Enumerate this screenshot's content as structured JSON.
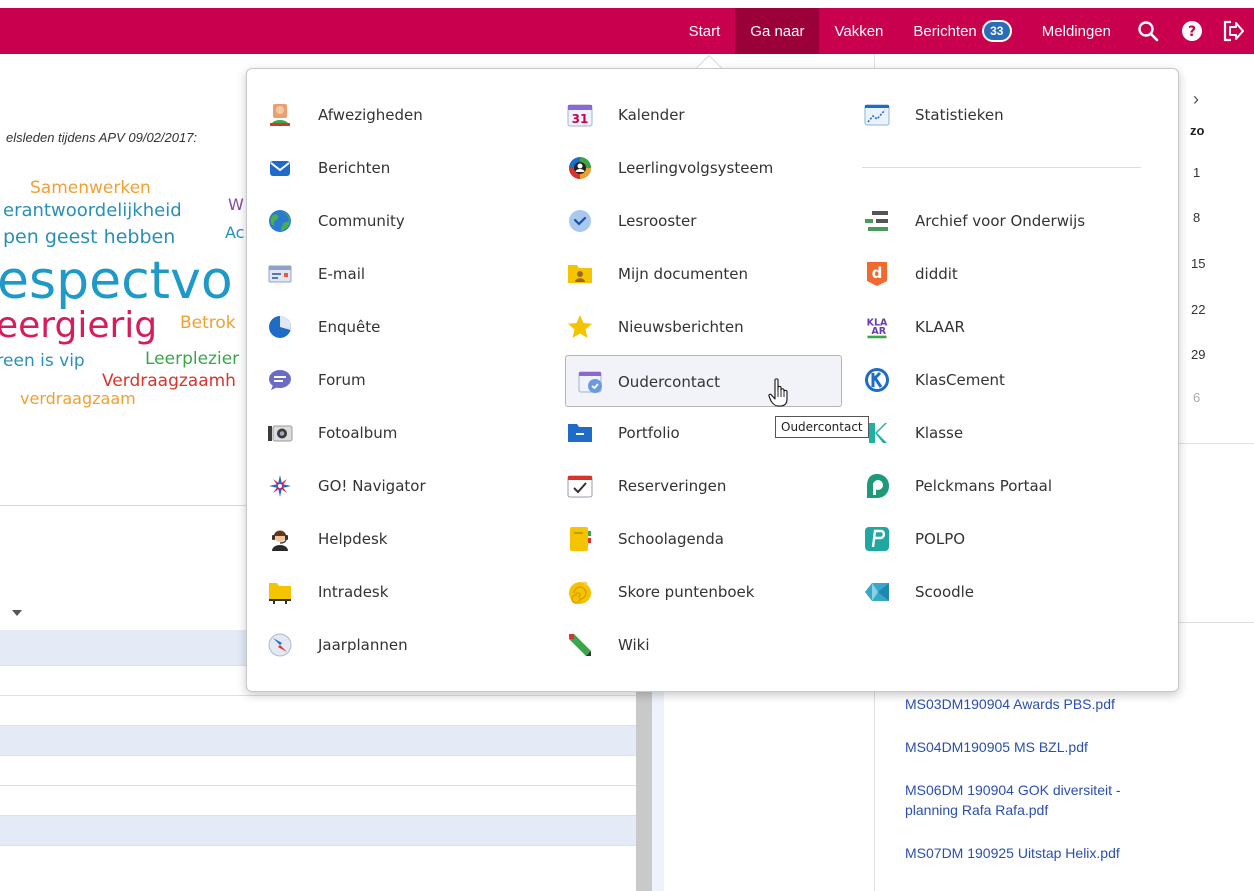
{
  "nav": {
    "start": "Start",
    "ga_naar": "Ga naar",
    "vakken": "Vakken",
    "berichten": "Berichten",
    "berichten_count": "33",
    "meldingen": "Meldingen",
    "icons": [
      "search-icon",
      "help-icon",
      "logout-icon"
    ]
  },
  "background": {
    "caption": "elsleden tijdens APV 09/02/2017:",
    "word_cloud": [
      {
        "text": "Samenwerken",
        "color": "#f0a030"
      },
      {
        "text": "erantwoordelijkheid",
        "color": "#2a8fb8"
      },
      {
        "text": "W",
        "color": "#8a4aa6"
      },
      {
        "text": "pen geest hebben",
        "color": "#2a8fb8"
      },
      {
        "text": "Ac",
        "color": "#2a8fb8"
      },
      {
        "text": "espectvo",
        "color": "#1f9ac8"
      },
      {
        "text": "eergierig",
        "color": "#d81b5c"
      },
      {
        "text": "Betrok",
        "color": "#f0a030"
      },
      {
        "text": "iedereen is vip",
        "color": "#2a8fb8"
      },
      {
        "text": "Leerplezier",
        "color": "#3aa64a"
      },
      {
        "text": "Verdraagzaamh",
        "color": "#d8342c"
      },
      {
        "text": "verdraagzaam",
        "color": "#f0a030"
      }
    ],
    "calendar": {
      "day_header": "zo",
      "days": [
        "1",
        "8",
        "15",
        "22",
        "29",
        "6"
      ]
    },
    "files": [
      "MS03DM190904 Awards PBS.pdf",
      "MS04DM190905 MS BZL.pdf",
      "MS06DM 190904 GOK diversiteit - planning Rafa Rafa.pdf",
      "MS07DM 190925 Uitstap Helix.pdf"
    ]
  },
  "menu": {
    "col1": [
      {
        "label": "Afwezigheden",
        "icon": "person-absence-icon"
      },
      {
        "label": "Berichten",
        "icon": "envelope-icon"
      },
      {
        "label": "Community",
        "icon": "globe-icon"
      },
      {
        "label": "E-mail",
        "icon": "email-card-icon"
      },
      {
        "label": "Enquête",
        "icon": "pie-chart-icon"
      },
      {
        "label": "Forum",
        "icon": "speech-bubble-icon"
      },
      {
        "label": "Fotoalbum",
        "icon": "camera-icon"
      },
      {
        "label": "GO! Navigator",
        "icon": "compass-star-icon"
      },
      {
        "label": "Helpdesk",
        "icon": "headset-icon"
      },
      {
        "label": "Intradesk",
        "icon": "folder-desk-icon"
      },
      {
        "label": "Jaarplannen",
        "icon": "compass-icon"
      }
    ],
    "col2": [
      {
        "label": "Kalender",
        "icon": "calendar-31-icon"
      },
      {
        "label": "Leerlingvolgsysteem",
        "icon": "student-tracking-icon"
      },
      {
        "label": "Lesrooster",
        "icon": "clock-icon"
      },
      {
        "label": "Mijn documenten",
        "icon": "folder-user-icon"
      },
      {
        "label": "Nieuwsberichten",
        "icon": "star-icon"
      },
      {
        "label": "Oudercontact",
        "icon": "calendar-clock-icon"
      },
      {
        "label": "Portfolio",
        "icon": "folder-blue-icon"
      },
      {
        "label": "Reserveringen",
        "icon": "calendar-check-icon"
      },
      {
        "label": "Schoolagenda",
        "icon": "agenda-icon"
      },
      {
        "label": "Skore puntenboek",
        "icon": "shell-icon"
      },
      {
        "label": "Wiki",
        "icon": "pencil-icon"
      }
    ],
    "col3_top": [
      {
        "label": "Statistieken",
        "icon": "line-chart-icon"
      }
    ],
    "col3": [
      {
        "label": "Archief voor Onderwijs",
        "icon": "archive-icon"
      },
      {
        "label": "diddit",
        "icon": "diddit-icon"
      },
      {
        "label": "KLAAR",
        "icon": "klaar-icon"
      },
      {
        "label": "KlasCement",
        "icon": "klascement-icon"
      },
      {
        "label": "Klasse",
        "icon": "klasse-icon"
      },
      {
        "label": "Pelckmans Portaal",
        "icon": "pelckmans-icon"
      },
      {
        "label": "POLPO",
        "icon": "polpo-icon"
      },
      {
        "label": "Scoodle",
        "icon": "scoodle-icon"
      }
    ],
    "hovered": "Oudercontact",
    "tooltip": "Oudercontact",
    "klaar_text": "KLA AR"
  },
  "colors": {
    "brand": "#c8004d",
    "brand_active": "#9b0039",
    "badge": "#2b6cb8",
    "link": "#2a4fb0"
  }
}
